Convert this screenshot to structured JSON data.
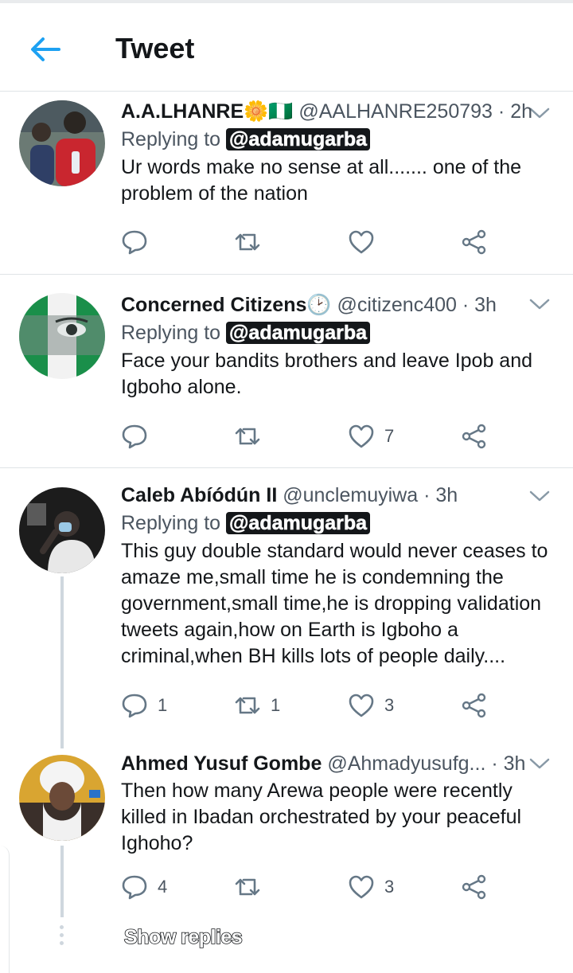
{
  "header": {
    "title": "Tweet"
  },
  "colors": {
    "accent": "#1da1f2",
    "text": "#14171a",
    "secondary": "#657786",
    "divider": "#dfe3e6"
  },
  "tweets": [
    {
      "name": "A.A.LHANRE🌼🇳🇬",
      "handle": "@AALHANRE250793",
      "time": "2h",
      "replying_label": "Replying to",
      "replying_to": "@adamugarba",
      "text": "Ur words make no sense at all....... one of the problem of the nation",
      "reply_count": "",
      "retweet_count": "",
      "like_count": ""
    },
    {
      "name": "Concerned Citizens🕑",
      "handle": "@citizenc400",
      "time": "3h",
      "replying_label": "Replying to",
      "replying_to": "@adamugarba",
      "text": "Face your bandits brothers and leave Ipob and Igboho alone.",
      "reply_count": "",
      "retweet_count": "",
      "like_count": "7"
    },
    {
      "name": "Caleb Abíódún II",
      "handle": "@unclemuyiwa",
      "time": "3h",
      "replying_label": "Replying to",
      "replying_to": "@adamugarba",
      "text": "This guy double standard would never ceases to amaze me,small time he is condemning the government,small time,he is dropping validation tweets again,how on Earth is Igboho a criminal,when BH kills lots of people daily....",
      "reply_count": "1",
      "retweet_count": "1",
      "like_count": "3"
    },
    {
      "name": "Ahmed Yusuf Gombe",
      "handle": "@Ahmadyusufg...",
      "time": "3h",
      "text": "Then how many Arewa people were recently killed in Ibadan orchestrated by your peaceful Ighoho?",
      "reply_count": "4",
      "retweet_count": "",
      "like_count": "3"
    }
  ],
  "show_replies_label": "Show replies",
  "icons": [
    "back-arrow-icon",
    "chevron-down-icon",
    "reply-icon",
    "retweet-icon",
    "like-icon",
    "share-icon"
  ]
}
